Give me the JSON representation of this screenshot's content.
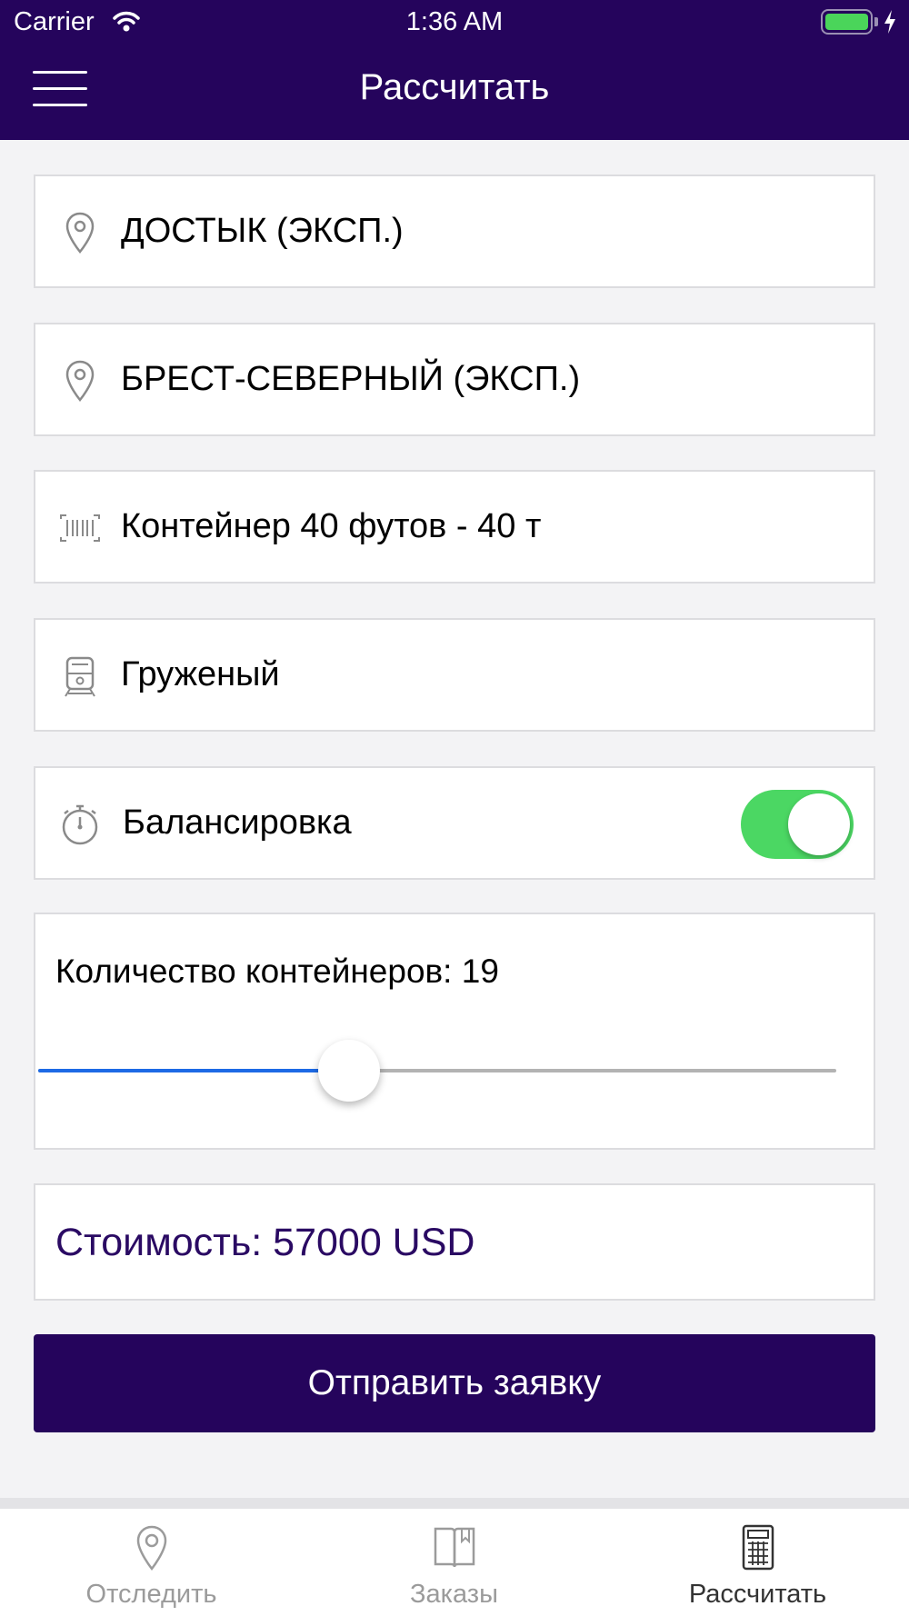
{
  "status_bar": {
    "carrier": "Carrier",
    "time": "1:36 AM"
  },
  "header": {
    "title": "Рассчитать",
    "menu_icon": "hamburger-icon"
  },
  "form": {
    "origin": {
      "value": "ДОСТЫК (ЭКСП.)",
      "icon": "map-pin-icon"
    },
    "destination": {
      "value": "БРЕСТ-СЕВЕРНЫЙ (ЭКСП.)",
      "icon": "map-pin-icon"
    },
    "container_type": {
      "value": "Контейнер 40 футов - 40 т",
      "icon": "barcode-icon"
    },
    "load_state": {
      "value": "Груженый",
      "icon": "train-icon"
    },
    "balancing": {
      "label": "Балансировка",
      "icon": "stopwatch-icon",
      "enabled": true
    },
    "quantity": {
      "label": "Количество контейнеров: 19",
      "value": 19,
      "fill_fraction": 0.39
    },
    "cost": {
      "label": "Стоимость: 57000 USD"
    },
    "submit_label": "Отправить заявку"
  },
  "tabs": [
    {
      "label": "Отследить",
      "icon": "map-pin-icon",
      "active": false
    },
    {
      "label": "Заказы",
      "icon": "book-icon",
      "active": false
    },
    {
      "label": "Рассчитать",
      "icon": "calculator-icon",
      "active": true
    }
  ],
  "colors": {
    "primary": "#25045c",
    "toggle_on": "#4bd763",
    "slider_fill": "#1d6ae5",
    "cost_text": "#2a0a63"
  }
}
